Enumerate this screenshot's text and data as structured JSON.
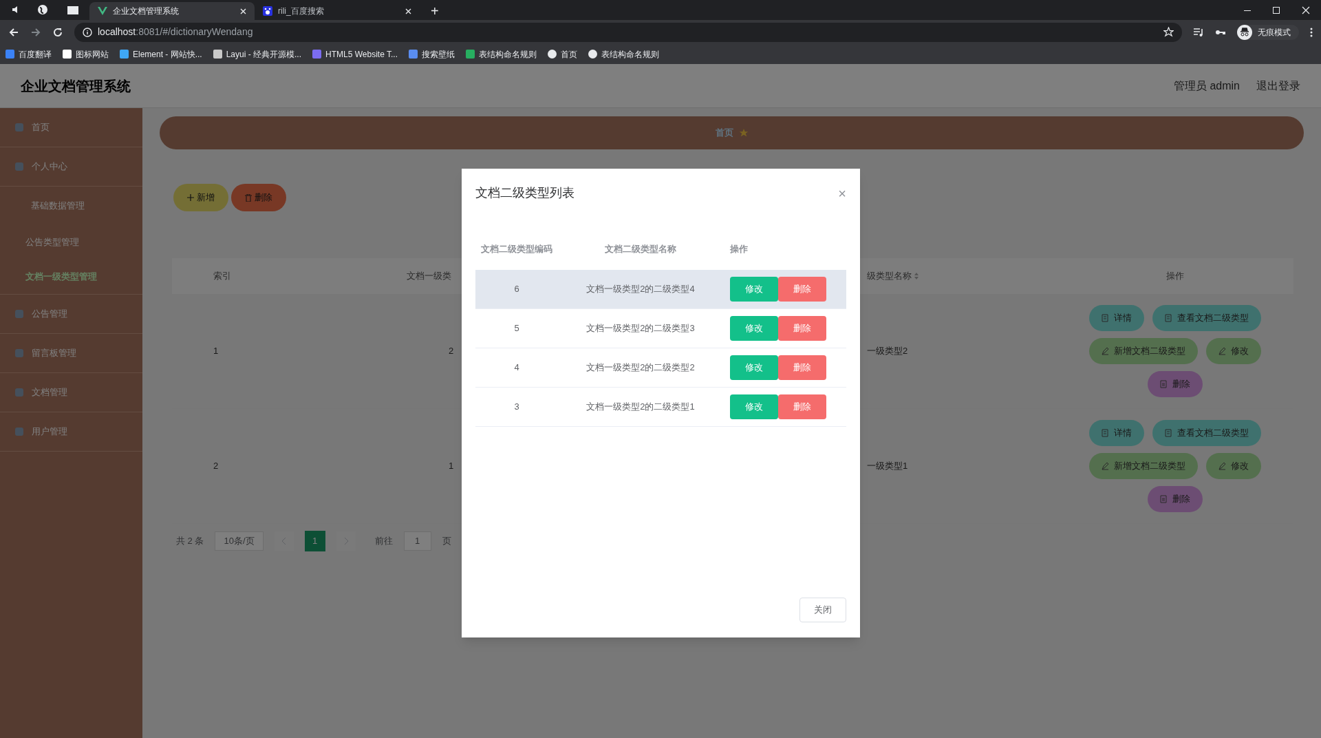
{
  "browser": {
    "tabs": [
      {
        "label": "企业文档管理系统",
        "selected": true
      },
      {
        "label": "rili_百度搜索",
        "selected": false
      }
    ],
    "url": {
      "host": "localhost",
      "rest": ":8081/#/dictionaryWendang"
    },
    "bookmarks": [
      "百度翻译",
      "图标网站",
      "Element - 网站快...",
      "Layui - 经典开源模...",
      "HTML5 Website T...",
      "搜索壁纸",
      "表结构命名规则",
      "首页",
      "表结构命名规则"
    ],
    "profile": "无痕模式",
    "new_tab": "+"
  },
  "header": {
    "title": "企业文档管理系统",
    "user": "管理员 admin",
    "logout": "退出登录"
  },
  "sidebar": {
    "items": [
      {
        "label": "首页",
        "selected": false
      },
      {
        "label": "个人中心",
        "selected": false
      },
      {
        "label": "基础数据管理",
        "selected": false,
        "children": [
          {
            "label": "公告类型管理",
            "selected": false
          },
          {
            "label": "文档一级类型管理",
            "selected": true
          }
        ]
      },
      {
        "label": "公告管理",
        "selected": false
      },
      {
        "label": "留言板管理",
        "selected": false
      },
      {
        "label": "文档管理",
        "selected": false
      },
      {
        "label": "用户管理",
        "selected": false
      }
    ]
  },
  "breadcrumb": {
    "home": "首页"
  },
  "toolbar": [
    {
      "label": "新增",
      "kind": "add"
    },
    {
      "label": "删除",
      "kind": "delete"
    }
  ],
  "table": {
    "columns": [
      "索引",
      "文档一级类",
      "级类型名称",
      "操作"
    ],
    "rows": [
      {
        "cells": [
          "1",
          "2",
          "一级类型2"
        ],
        "actions": [
          {
            "label": "详情",
            "kind": "detail"
          },
          {
            "label": "查看文档二级类型",
            "kind": "detail"
          },
          {
            "label": "新增文档二级类型",
            "kind": "edit"
          },
          {
            "label": "修改",
            "kind": "edit"
          },
          {
            "label": "删除",
            "kind": "delete"
          }
        ]
      },
      {
        "cells": [
          "2",
          "1",
          "一级类型1"
        ],
        "actions": [
          {
            "label": "详情",
            "kind": "detail"
          },
          {
            "label": "查看文档二级类型",
            "kind": "detail"
          },
          {
            "label": "新增文档二级类型",
            "kind": "edit"
          },
          {
            "label": "修改",
            "kind": "edit"
          },
          {
            "label": "删除",
            "kind": "delete"
          }
        ]
      }
    ]
  },
  "pagination": {
    "total": "共 2 条",
    "page_size": "10条/页",
    "pages": [
      {
        "label": "1",
        "selected": true
      }
    ],
    "goto": "前往",
    "goto_value": "1",
    "page_unit": "页"
  },
  "dialog": {
    "title": "文档二级类型列表",
    "close": "×",
    "columns": [
      "文档二级类型编码",
      "文档二级类型名称",
      "操作"
    ],
    "rows": [
      {
        "code": "6",
        "name": "文档一级类型2的二级类型4",
        "hovered": true,
        "actions": [
          "修改",
          "删除"
        ]
      },
      {
        "code": "5",
        "name": "文档一级类型2的二级类型3",
        "hovered": false,
        "actions": [
          "修改",
          "删除"
        ]
      },
      {
        "code": "4",
        "name": "文档一级类型2的二级类型2",
        "hovered": false,
        "actions": [
          "修改",
          "删除"
        ]
      },
      {
        "code": "3",
        "name": "文档一级类型2的二级类型1",
        "hovered": false,
        "actions": [
          "修改",
          "删除"
        ]
      }
    ],
    "footer_button": "关闭"
  }
}
